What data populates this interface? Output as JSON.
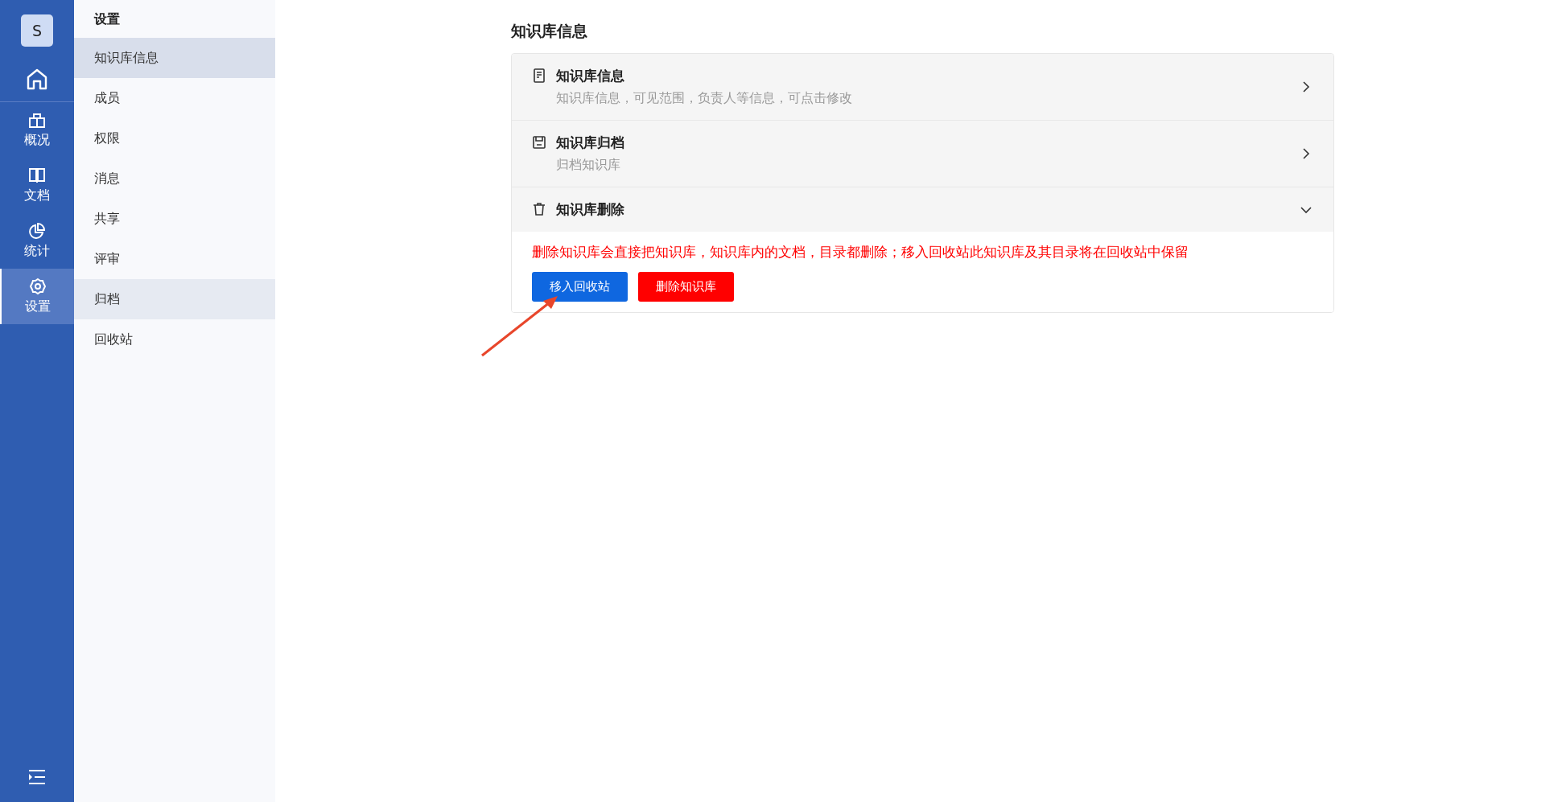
{
  "rail": {
    "avatar": "S",
    "items": [
      {
        "kind": "overview",
        "label": "概况",
        "selected": false
      },
      {
        "kind": "docs",
        "label": "文档",
        "selected": false
      },
      {
        "kind": "stats",
        "label": "统计",
        "selected": false
      },
      {
        "kind": "settings",
        "label": "设置",
        "selected": true
      }
    ]
  },
  "sidebar": {
    "title": "设置",
    "items": [
      {
        "label": "知识库信息",
        "selected": true,
        "hovered": false
      },
      {
        "label": "成员",
        "selected": false,
        "hovered": false
      },
      {
        "label": "权限",
        "selected": false,
        "hovered": false
      },
      {
        "label": "消息",
        "selected": false,
        "hovered": false
      },
      {
        "label": "共享",
        "selected": false,
        "hovered": false
      },
      {
        "label": "评审",
        "selected": false,
        "hovered": false
      },
      {
        "label": "归档",
        "selected": false,
        "hovered": true
      },
      {
        "label": "回收站",
        "selected": false,
        "hovered": false
      }
    ]
  },
  "page": {
    "title": "知识库信息",
    "sections": [
      {
        "kind": "info",
        "title": "知识库信息",
        "description": "知识库信息，可见范围，负责人等信息，可点击修改",
        "expanded": false
      },
      {
        "kind": "archive",
        "title": "知识库归档",
        "description": "归档知识库",
        "expanded": false
      },
      {
        "kind": "delete",
        "title": "知识库删除",
        "expanded": true,
        "warning": "删除知识库会直接把知识库，知识库内的文档，目录都删除；移入回收站此知识库及其目录将在回收站中保留",
        "buttons": [
          {
            "label": "移入回收站",
            "kind": "primary"
          },
          {
            "label": "删除知识库",
            "kind": "danger"
          }
        ]
      }
    ]
  }
}
